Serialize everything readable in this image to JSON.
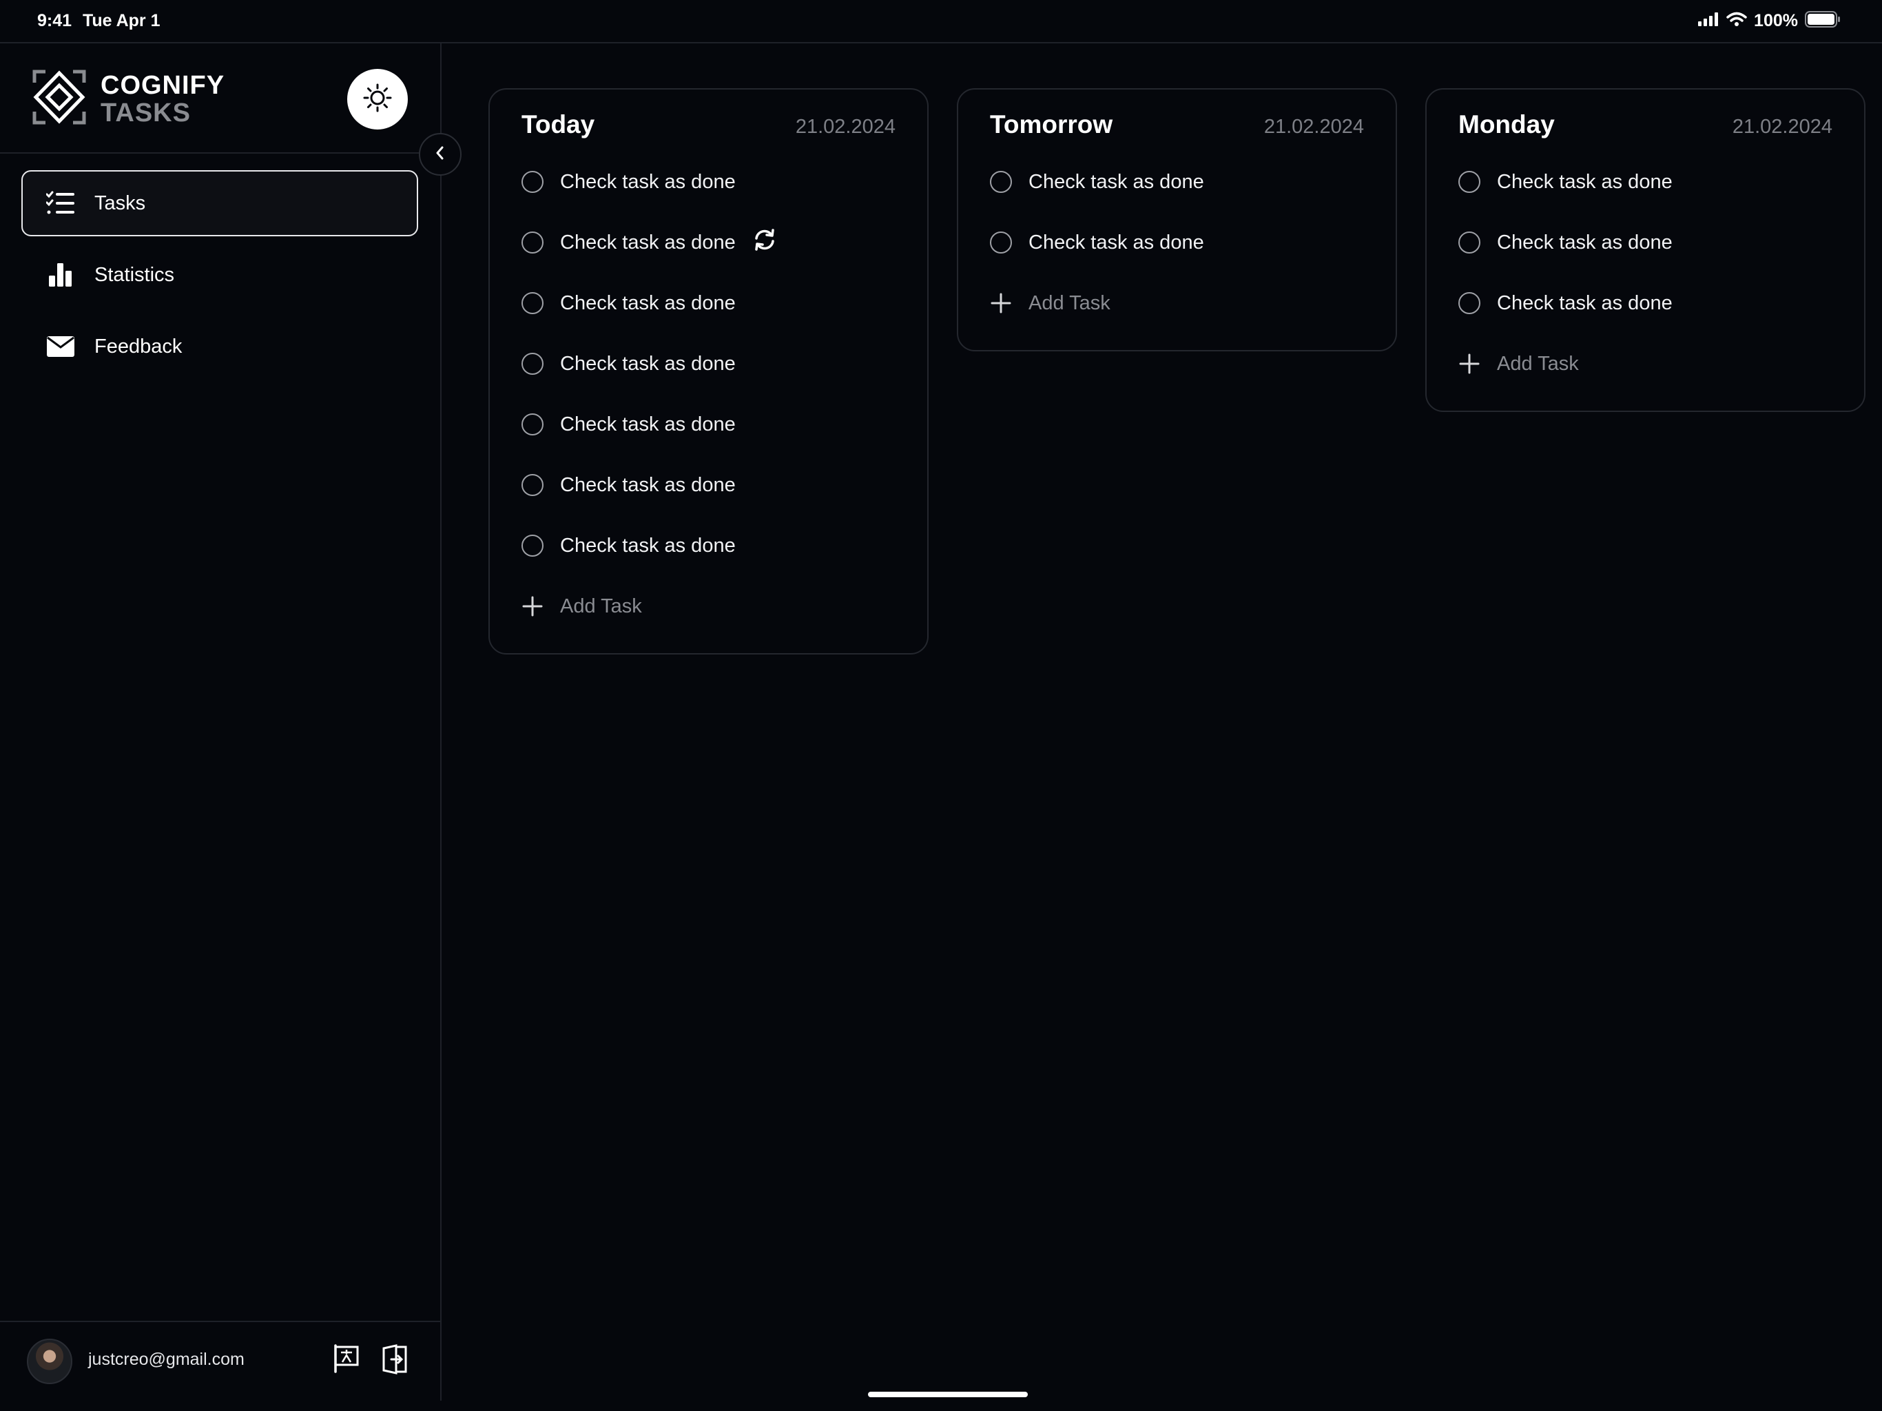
{
  "status_bar": {
    "time": "9:41",
    "date": "Tue Apr 1",
    "battery": "100%",
    "icons": [
      "signal-icon",
      "wifi-icon",
      "battery-icon"
    ]
  },
  "brand": {
    "line1": "COGNIFY",
    "line2": "TASKS",
    "logo_icon": "diamond-logo-icon"
  },
  "theme_toggle": {
    "icon": "sun-icon"
  },
  "collapse": {
    "icon": "chevron-left-icon"
  },
  "nav": {
    "items": [
      {
        "label": "Tasks",
        "icon": "checklist-icon",
        "active": true
      },
      {
        "label": "Statistics",
        "icon": "bar-chart-icon",
        "active": false
      },
      {
        "label": "Feedback",
        "icon": "mail-icon",
        "active": false
      }
    ]
  },
  "user": {
    "email": "justcreo@gmail.com",
    "footer_icons": [
      "language-flag-icon",
      "logout-door-icon"
    ]
  },
  "columns": [
    {
      "title": "Today",
      "date": "21.02.2024",
      "tasks": [
        {
          "label": "Check task as done",
          "recurring": false
        },
        {
          "label": "Check task as done",
          "recurring": true
        },
        {
          "label": "Check task as done",
          "recurring": false
        },
        {
          "label": "Check task as done",
          "recurring": false
        },
        {
          "label": "Check task as done",
          "recurring": false
        },
        {
          "label": "Check task as done",
          "recurring": false
        },
        {
          "label": "Check task as done",
          "recurring": false
        }
      ],
      "add_label": "Add Task"
    },
    {
      "title": "Tomorrow",
      "date": "21.02.2024",
      "tasks": [
        {
          "label": "Check task as done",
          "recurring": false
        },
        {
          "label": "Check task as done",
          "recurring": false
        }
      ],
      "add_label": "Add Task"
    },
    {
      "title": "Monday",
      "date": "21.02.2024",
      "tasks": [
        {
          "label": "Check task as done",
          "recurring": false
        },
        {
          "label": "Check task as done",
          "recurring": false
        },
        {
          "label": "Check task as done",
          "recurring": false
        }
      ],
      "add_label": "Add Task"
    }
  ],
  "colors": {
    "background": "#05070c",
    "border": "#24272e",
    "text": "#ffffff",
    "muted": "#7e8087"
  }
}
